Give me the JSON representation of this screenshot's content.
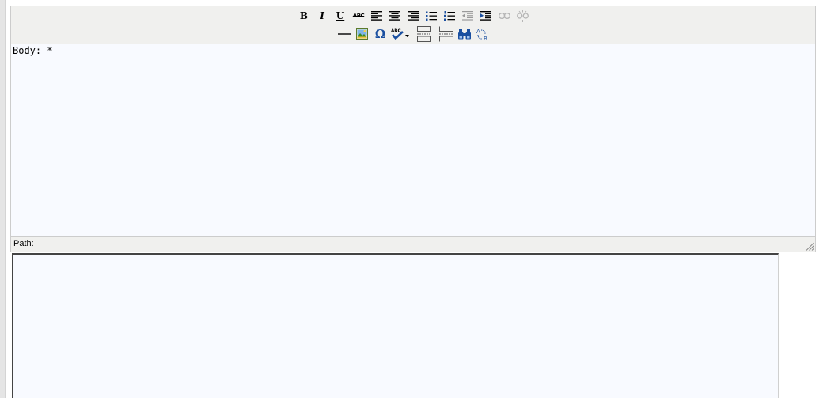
{
  "editor": {
    "body_label": "Body: *",
    "path_label": "Path:",
    "textarea_value": "",
    "toolbar": {
      "bold_glyph": "B",
      "italic_glyph": "I",
      "underline_glyph": "U",
      "strikethrough_glyph": "ABC",
      "charmap_glyph": "Ω"
    }
  },
  "colors": {
    "toolbar_bg": "#f0f0ee",
    "editor_bg": "#f8faff",
    "border": "#cccccc",
    "icon_blue": "#1a4fa0"
  }
}
